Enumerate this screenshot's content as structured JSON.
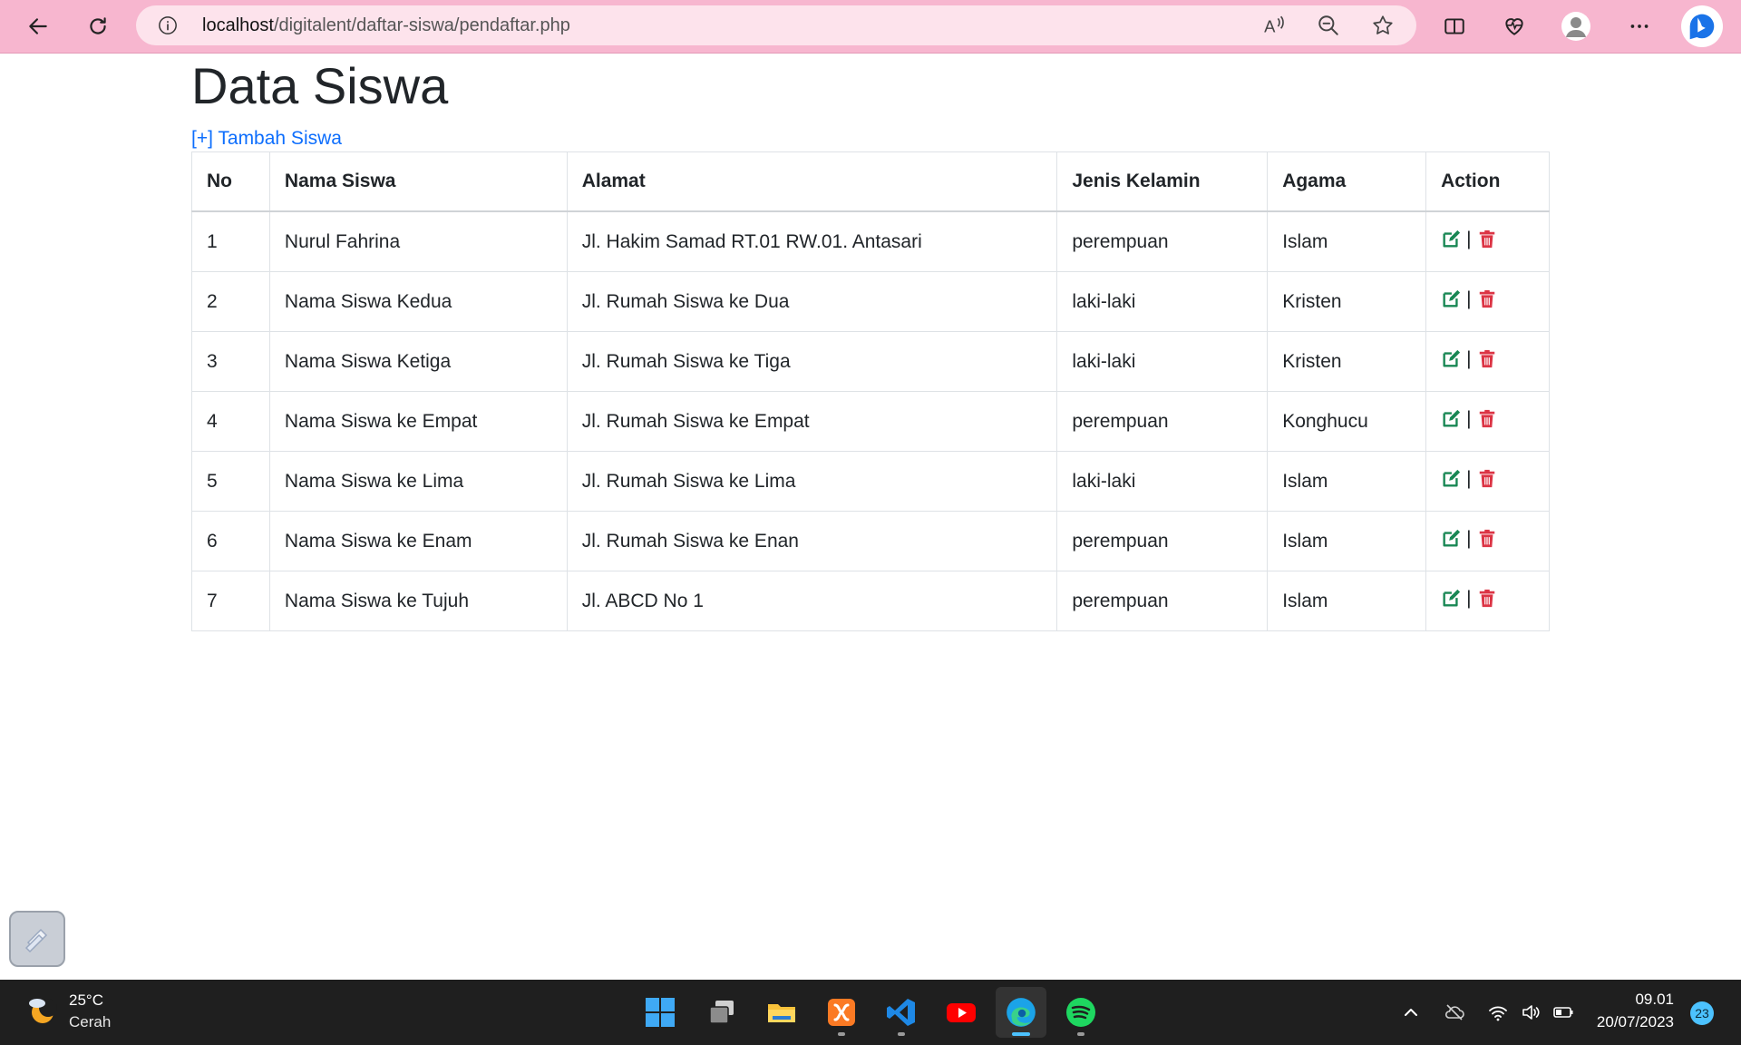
{
  "browser": {
    "url_host": "localhost",
    "url_path": "/digitalent/daftar-siswa/pendaftar.php"
  },
  "page": {
    "title": "Data Siswa",
    "add_link": "[+] Tambah Siswa"
  },
  "table": {
    "headers": [
      "No",
      "Nama Siswa",
      "Alamat",
      "Jenis Kelamin",
      "Agama",
      "Action"
    ],
    "action_separator": "|",
    "rows": [
      [
        "1",
        "Nurul Fahrina",
        "Jl. Hakim Samad RT.01 RW.01. Antasari",
        "perempuan",
        "Islam"
      ],
      [
        "2",
        "Nama Siswa Kedua",
        "Jl. Rumah Siswa ke Dua",
        "laki-laki",
        "Kristen"
      ],
      [
        "3",
        "Nama Siswa Ketiga",
        "Jl. Rumah Siswa ke Tiga",
        "laki-laki",
        "Kristen"
      ],
      [
        "4",
        "Nama Siswa ke Empat",
        "Jl. Rumah Siswa ke Empat",
        "perempuan",
        "Konghucu"
      ],
      [
        "5",
        "Nama Siswa ke Lima",
        "Jl. Rumah Siswa ke Lima",
        "laki-laki",
        "Islam"
      ],
      [
        "6",
        "Nama Siswa ke Enam",
        "Jl. Rumah Siswa ke Enan",
        "perempuan",
        "Islam"
      ],
      [
        "7",
        "Nama Siswa ke Tujuh",
        "Jl. ABCD No 1",
        "perempuan",
        "Islam"
      ]
    ]
  },
  "taskbar": {
    "weather_temp": "25°C",
    "weather_desc": "Cerah",
    "clock_time": "09.01",
    "clock_date": "20/07/2023",
    "notification_count": "23",
    "apps": [
      "windows-start",
      "task-view",
      "file-explorer",
      "xampp",
      "vscode",
      "youtube",
      "edge",
      "spotify"
    ]
  },
  "colors": {
    "browser_bar": "#f7b6cf",
    "address_bar": "#fde3ec",
    "link": "#0d6efd",
    "edit_icon": "#198754",
    "delete_icon": "#dc3545",
    "taskbar": "#1f1f1f"
  }
}
